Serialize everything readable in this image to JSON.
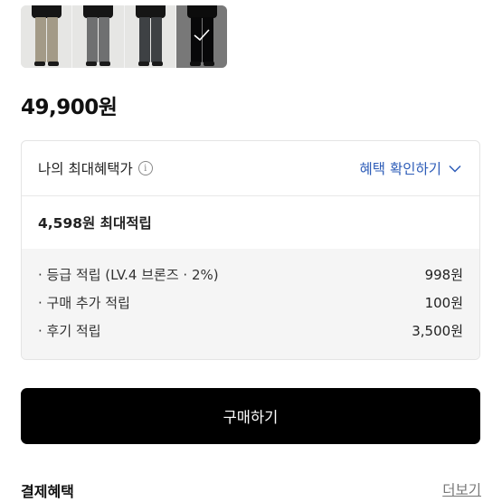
{
  "product_thumbnails": {
    "items": [
      {
        "pants_color": "#a39a87",
        "selected": false
      },
      {
        "pants_color": "#6f7071",
        "selected": false
      },
      {
        "pants_color": "#3e4144",
        "selected": false
      },
      {
        "pants_color": "#0f0f10",
        "selected": true,
        "icon": "check-icon"
      }
    ]
  },
  "price": "49,900원",
  "benefit": {
    "title": "나의 최대혜택가",
    "info_icon": "info-icon",
    "check_link": "혜택 확인하기",
    "check_link_icon": "chevron-down-icon",
    "link_color": "#2e5db8",
    "max_points": "4,598원 최대적립",
    "rows": [
      {
        "label": "· 등급 적립 (LV.4 브론즈 · 2%)",
        "amount": "998원"
      },
      {
        "label": "· 구매 추가 적립",
        "amount": "100원"
      },
      {
        "label": "· 후기 적립",
        "amount": "3,500원"
      }
    ]
  },
  "buy_button": "구매하기",
  "payment_benefits": {
    "title": "결제혜택",
    "more": "더보기"
  }
}
